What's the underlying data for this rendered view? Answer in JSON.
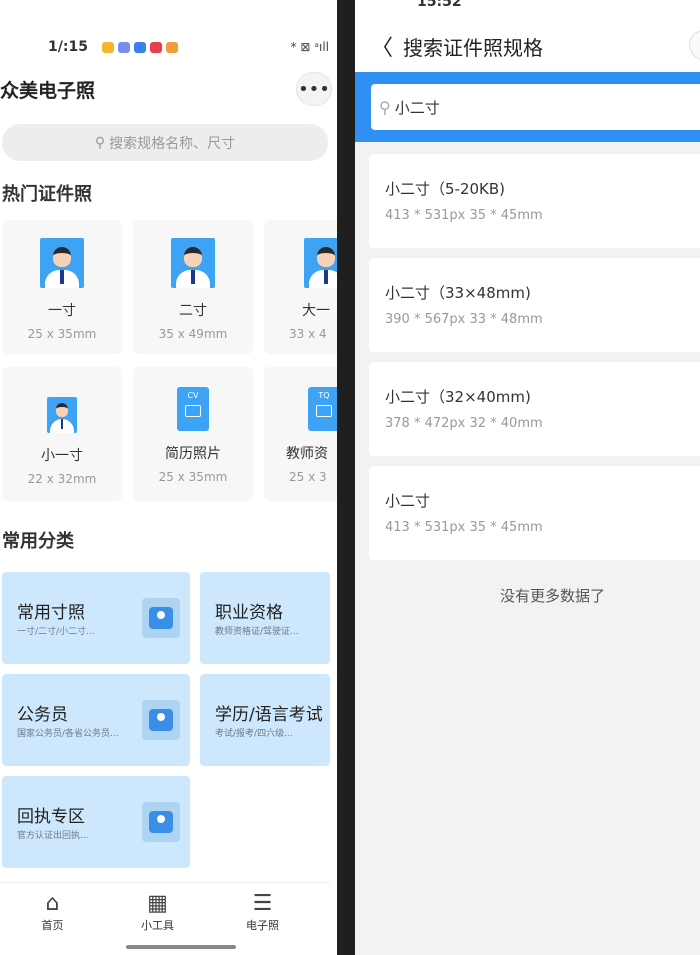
{
  "left": {
    "status": {
      "time": "1/:15",
      "right": "* ⊠ ᵃıll"
    },
    "app_title": "众美电子照",
    "more_label": "•••",
    "search_placeholder": "搜索规格名称、尺寸",
    "hot_title": "热门证件照",
    "hot_cards": [
      {
        "name": "一寸",
        "size": "25 x 35mm",
        "icon": "person-photo-icon"
      },
      {
        "name": "二寸",
        "size": "35 x 49mm",
        "icon": "person-photo-icon"
      },
      {
        "name": "大一",
        "size": "33 x 4",
        "icon": "person-photo-icon"
      },
      {
        "name": "小一寸",
        "size": "22 x 32mm",
        "icon": "person-photo-icon"
      },
      {
        "name": "简历照片",
        "size": "25 x 35mm",
        "icon": "resume-icon",
        "badge": "CV"
      },
      {
        "name": "教师资",
        "size": "25 x 3",
        "icon": "teacher-cert-icon",
        "badge": "TQ"
      }
    ],
    "categories_title": "常用分类",
    "categories": [
      {
        "title": "常用寸照",
        "subtitle": "一寸/二寸/小二寸...",
        "icon": "id-card-icon"
      },
      {
        "title": "职业资格",
        "subtitle": "教师资格证/驾驶证...",
        "icon": "certificate-icon"
      },
      {
        "title": "公务员",
        "subtitle": "国家公务员/各省公务员...",
        "icon": "civil-servant-icon"
      },
      {
        "title": "学历/语言考试",
        "subtitle": "考试/报考/四六级...",
        "icon": "exam-icon"
      },
      {
        "title": "回执专区",
        "subtitle": "官方认证出回执...",
        "icon": "receipt-icon"
      }
    ],
    "nav": [
      {
        "label": "首页",
        "icon": "home-icon"
      },
      {
        "label": "小工具",
        "icon": "tools-grid-icon"
      },
      {
        "label": "电子照",
        "icon": "document-list-icon"
      }
    ]
  },
  "right": {
    "status": {
      "time": "15:52"
    },
    "page_title": "搜索证件照规格",
    "search_value": "小二寸",
    "results": [
      {
        "title": "小二寸（5-20KB)",
        "spec": "413 * 531px   35 * 45mm"
      },
      {
        "title": "小二寸（33×48mm)",
        "spec": "390 * 567px   33 * 48mm"
      },
      {
        "title": "小二寸（32×40mm)",
        "spec": "378 * 472px   32 * 40mm"
      },
      {
        "title": "小二寸",
        "spec": "413 * 531px   35 * 45mm"
      }
    ],
    "no_more": "没有更多数据了"
  },
  "colors": {
    "accent": "#2f8ff3",
    "category_bg": "#cde8fc",
    "photo_bg": "#3da4f5"
  }
}
